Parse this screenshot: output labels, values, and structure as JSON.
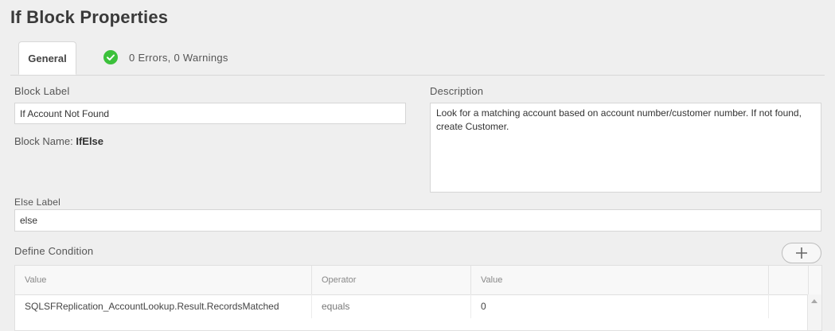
{
  "page": {
    "title": "If Block Properties"
  },
  "tabs": {
    "general_label": "General",
    "status_text": "0 Errors, 0 Warnings",
    "status_icon": "check-circle-icon",
    "status_color": "#3cc13b"
  },
  "block_label": {
    "label": "Block Label",
    "value": "If Account Not Found"
  },
  "block_name": {
    "label": "Block Name:",
    "value": "IfElse"
  },
  "description": {
    "label": "Description",
    "value": "Look for a matching account based on account number/customer number. If not found, create Customer."
  },
  "else_label": {
    "label": "Else Label",
    "value": "else"
  },
  "condition": {
    "label": "Define Condition",
    "add_icon": "plus-icon",
    "columns": [
      "Value",
      "Operator",
      "Value"
    ],
    "rows": [
      {
        "left_value": "SQLSFReplication_AccountLookup.Result.RecordsMatched",
        "operator": "equals",
        "right_value": "0"
      }
    ]
  }
}
